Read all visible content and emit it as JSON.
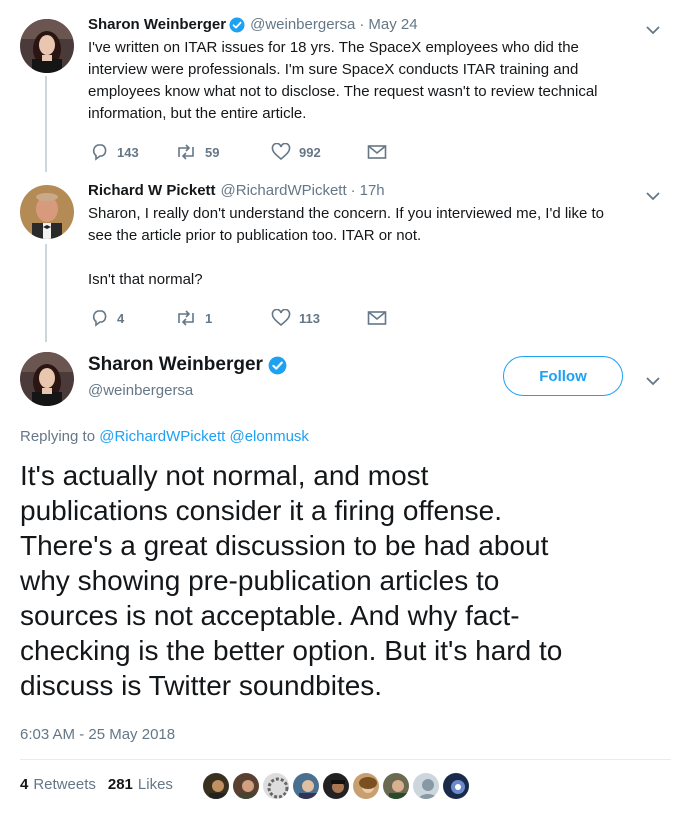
{
  "tweets": [
    {
      "name": "Sharon Weinberger",
      "handle": "@weinbergersa",
      "time": "May 24",
      "text": "I've written on ITAR issues for 18 yrs. The SpaceX employees who did the\ninterview were professionals. I'm sure SpaceX conducts ITAR training and\nemployees know what not to disclose. The request wasn't to review technical\ninformation, but the entire article.",
      "replies": "143",
      "retweets": "59",
      "likes": "992"
    },
    {
      "name": "Richard W Pickett",
      "handle": "@RichardWPickett",
      "time": "17h",
      "text": "Sharon, I really don't understand the concern. If you interviewed me, I'd like to\nsee the article prior to publication too. ITAR or not.\n\nIsn't that normal?",
      "replies": "4",
      "retweets": "1",
      "likes": "113"
    }
  ],
  "main_tweet": {
    "name": "Sharon Weinberger",
    "handle": "@weinbergersa",
    "follow_label": "Follow",
    "replying_prefix": "Replying to",
    "mention_1": "@RichardWPickett",
    "mention_2": "@elonmusk",
    "text": "It's actually not normal, and most\npublications consider it a firing offense.\nThere's a great discussion to be had about\nwhy showing pre-publication articles to\nsources is not acceptable. And why fact-\nchecking is the better option. But it's hard to\ndiscuss is Twitter soundbites.",
    "timestamp": "6:03 AM - 25 May 2018",
    "retweets_count": "4",
    "retweets_label": "Retweets",
    "likes_count": "281",
    "likes_label": "Likes"
  },
  "colors": {
    "accent": "#1da1f2",
    "muted": "#657786",
    "text": "#14171a",
    "border": "#e6ecf0"
  },
  "icons": [
    "verified-badge-icon",
    "chevron-down-icon",
    "reply-icon",
    "retweet-icon",
    "like-icon",
    "direct-message-icon"
  ]
}
